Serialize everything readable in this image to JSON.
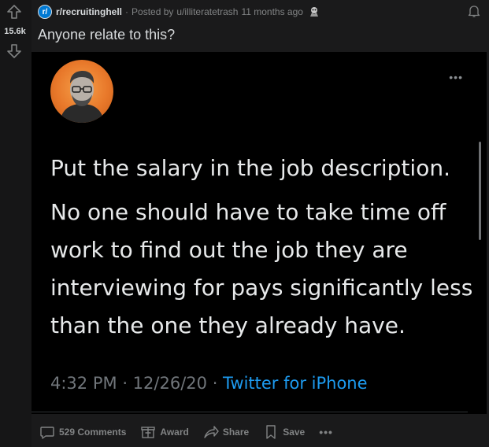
{
  "post": {
    "score": "15.6k",
    "subreddit": "r/recruitinghell",
    "posted_by_prefix": "Posted by",
    "username": "u/illiteratetrash",
    "time_ago": "11 months ago",
    "title": "Anyone relate to this?"
  },
  "tweet": {
    "paragraph_1": "Put the salary in the job description.",
    "paragraph_2": "No one should have to take time off work to find out the job they are interviewing for pays significantly less than the one they already have.",
    "time": "4:32 PM",
    "date": "12/26/20",
    "source": "Twitter for iPhone",
    "more": "•••"
  },
  "actions": {
    "comments": "529 Comments",
    "award": "Award",
    "share": "Share",
    "save": "Save",
    "more": "•••"
  },
  "colors": {
    "background": "#1a1a1b",
    "vote_column": "#161617",
    "text": "#d7dadc",
    "muted": "#818384",
    "twitter_blue": "#1d9bf0",
    "subreddit_blue": "#0079d3"
  }
}
